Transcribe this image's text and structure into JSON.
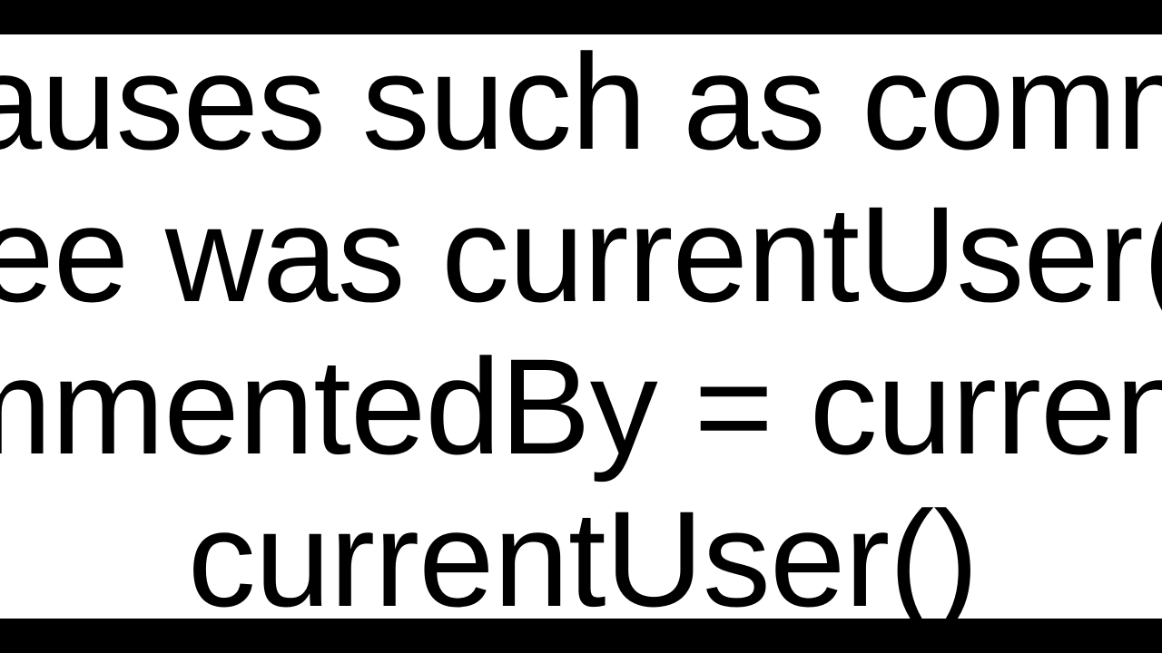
{
  "text": {
    "line1": "lauses such as comm",
    "line2": "ee was currentUser(",
    "line3": "mmentedBy = current",
    "line4": "currentUser()"
  }
}
